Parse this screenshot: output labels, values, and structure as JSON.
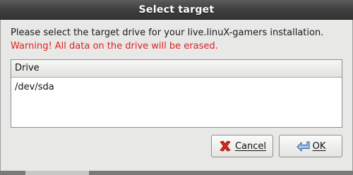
{
  "window": {
    "title": "Select target"
  },
  "messages": {
    "info": "Please select the target drive for your live.linuX-gamers installation.",
    "warning": "Warning! All data on the drive will be erased."
  },
  "drive_list": {
    "column_header": "Drive",
    "rows": [
      "/dev/sda"
    ]
  },
  "buttons": {
    "cancel": {
      "label": "Cancel",
      "icon": "cancel-x-icon"
    },
    "ok": {
      "label": "OK",
      "icon": "ok-arrow-icon"
    }
  },
  "colors": {
    "warning_text": "#e02020",
    "titlebar": "#3f3f3f"
  }
}
